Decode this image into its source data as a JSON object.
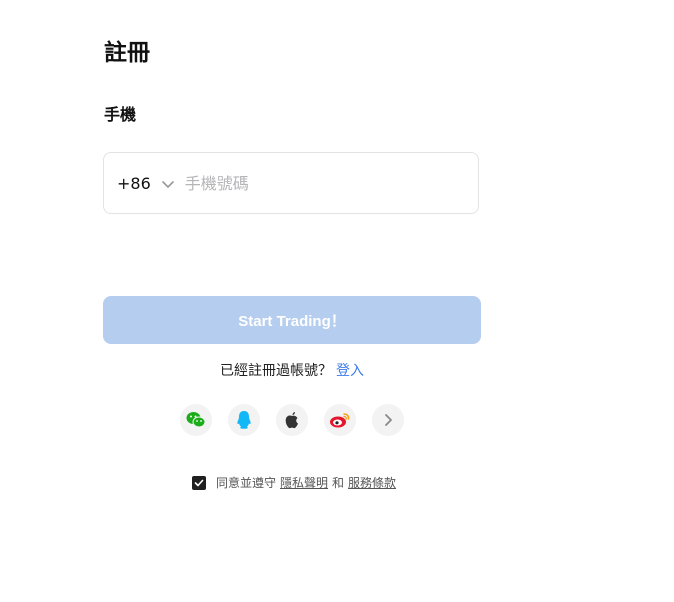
{
  "title": "註冊",
  "tab": {
    "label": "手機"
  },
  "phone": {
    "country_code": "+86",
    "placeholder": "手機號碼"
  },
  "submit_label": "Start Trading！",
  "login": {
    "prompt": "已經註冊過帳號？",
    "link": "登入"
  },
  "socials": [
    {
      "name": "wechat",
      "icon": "wechat-icon",
      "color": "#1aad19"
    },
    {
      "name": "qq",
      "icon": "qq-icon",
      "color": "#12b7f5"
    },
    {
      "name": "apple",
      "icon": "apple-icon",
      "color": "#333333"
    },
    {
      "name": "weibo",
      "icon": "weibo-icon",
      "color": "#e6162d"
    },
    {
      "name": "more",
      "icon": "chevron-right-icon",
      "color": "#888888"
    }
  ],
  "agreement": {
    "checked": true,
    "prefix": "同意並遵守",
    "privacy": "隱私聲明",
    "and": "和",
    "terms": "服務條款"
  },
  "colors": {
    "accent": "#3d7be8",
    "button_disabled": "#b5cdef",
    "tab_underline": "#f0a870"
  }
}
